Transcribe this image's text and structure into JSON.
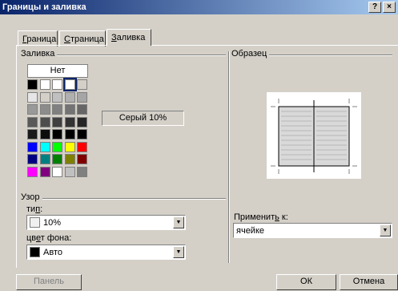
{
  "window": {
    "title": "Границы и заливка",
    "help_btn": "?",
    "close_btn": "×"
  },
  "tabs": [
    {
      "label": "Граница",
      "mnemonic": "Г",
      "rest": "раница",
      "active": false
    },
    {
      "label": "Страница",
      "mnemonic": "С",
      "rest": "траница",
      "active": false
    },
    {
      "label": "Заливка",
      "mnemonic": "З",
      "rest": "аливка",
      "active": true
    }
  ],
  "fill": {
    "group_label": "Заливка",
    "none_label": "Нет",
    "selected_name": "Серый 10%",
    "palette": [
      [
        "#000000",
        "#ffffff",
        "#ffffff",
        "#ffffff",
        "#d4d0c8"
      ],
      [
        "#e6e6e6",
        "#d4d0c8",
        "#c0c0c0",
        "#b0b0b0",
        "#a6a6a6"
      ],
      [
        "#999999",
        "#8c8c8c",
        "#808080",
        "#737373",
        "#666666"
      ],
      [
        "#595959",
        "#4d4d4d",
        "#404040",
        "#333333",
        "#262626"
      ],
      [
        "#1a1a1a",
        "#0d0d0d",
        "#000000",
        "#000000",
        "#000000"
      ],
      [
        "#0000ff",
        "#00ffff",
        "#00ff00",
        "#ffff00",
        "#ff0000"
      ],
      [
        "#000080",
        "#008080",
        "#008000",
        "#808000",
        "#800000"
      ],
      [
        "#ff00ff",
        "#800080",
        "#ffffff",
        "#c0c0c0",
        "#808080"
      ]
    ],
    "selected_swatch": "0-3"
  },
  "pattern": {
    "group_label": "Узор",
    "type_label": "тип:",
    "type_mnemonic": "п",
    "type_value": "10%",
    "type_chip_color": "#f0f0f0",
    "bg_label": "цвет фона:",
    "bg_mnemonic": "е",
    "bg_value": "Авто",
    "bg_chip_color": "#000000"
  },
  "preview": {
    "group_label": "Образец"
  },
  "apply": {
    "label": "Применить к:",
    "mnemonic": "ь",
    "value": "ячейке"
  },
  "buttons": {
    "panel": "Панель",
    "ok": "ОК",
    "cancel": "Отмена"
  }
}
